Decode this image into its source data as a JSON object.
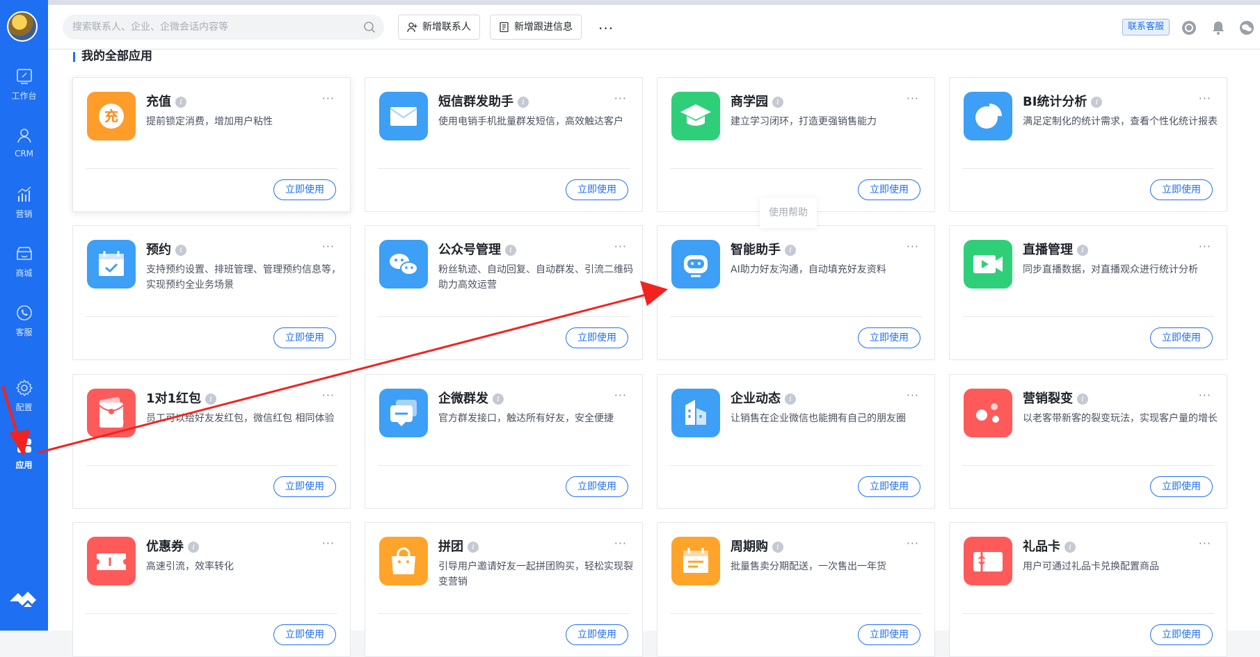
{
  "sidebar": {
    "items": [
      {
        "label": "工作台",
        "icon": "workbench-icon"
      },
      {
        "label": "CRM",
        "icon": "user-icon"
      },
      {
        "label": "营销",
        "icon": "marketing-chart-icon"
      },
      {
        "label": "商城",
        "icon": "store-icon"
      },
      {
        "label": "客服",
        "icon": "phone-chat-icon"
      },
      {
        "label": "配置",
        "icon": "gear-icon"
      },
      {
        "label": "应用",
        "icon": "apps-grid-icon"
      }
    ],
    "active": "应用"
  },
  "topbar": {
    "search_placeholder": "搜索联系人、企业、企微会话内容等",
    "add_contact": "新增联系人",
    "add_followup": "新增跟进信息",
    "support": "联系客服"
  },
  "section": {
    "title": "我的全部应用"
  },
  "tooltip": "使用帮助",
  "use_label": "立即使用",
  "cards": [
    {
      "name": "充值",
      "desc": "提前锁定消费，增加用户粘性",
      "icon": "recharge-icon",
      "color": "#ff9c2a"
    },
    {
      "name": "短信群发助手",
      "desc": "使用电销手机批量群发短信，高效触达客户",
      "icon": "sms-envelope-icon",
      "color": "#3d9ff5"
    },
    {
      "name": "商学园",
      "desc": "建立学习闭环，打造更强销售能力",
      "icon": "graduation-cap-icon",
      "color": "#2fcf7a"
    },
    {
      "name": "BI统计分析",
      "desc": "满足定制化的统计需求，查看个性化统计报表",
      "icon": "pie-chart-icon",
      "color": "#3d9ff5"
    },
    {
      "name": "预约",
      "desc": "支持预约设置、排班管理、管理预约信息等，实现预约全业务场景",
      "icon": "calendar-check-icon",
      "color": "#3d9ff5"
    },
    {
      "name": "公众号管理",
      "desc": "粉丝轨迹、自动回复、自动群发、引流二维码 助力高效运营",
      "icon": "wechat-icon",
      "color": "#3d9ff5"
    },
    {
      "name": "智能助手",
      "desc": "AI助力好友沟通，自动填充好友资料",
      "icon": "robot-icon",
      "color": "#3d9ff5"
    },
    {
      "name": "直播管理",
      "desc": "同步直播数据，对直播观众进行统计分析",
      "icon": "video-camera-icon",
      "color": "#2fcf7a"
    },
    {
      "name": "1对1红包",
      "desc": "员工可以给好友发红包，微信红包 相同体验",
      "icon": "red-packet-icon",
      "color": "#ff5a5a"
    },
    {
      "name": "企微群发",
      "desc": "官方群发接口，触达所有好友，安全便捷",
      "icon": "group-message-icon",
      "color": "#3d9ff5"
    },
    {
      "name": "企业动态",
      "desc": "让销售在企业微信也能拥有自己的朋友圈",
      "icon": "building-icon",
      "color": "#3d9ff5"
    },
    {
      "name": "营销裂变",
      "desc": "以老客带新客的裂变玩法，实现客户量的增长",
      "icon": "fission-dots-icon",
      "color": "#ff5a5a"
    },
    {
      "name": "优惠券",
      "desc": "高速引流，效率转化",
      "icon": "coupon-icon",
      "color": "#ff5a5a"
    },
    {
      "name": "拼团",
      "desc": "引导用户邀请好友一起拼团购买，轻松实现裂变营销",
      "icon": "shopping-bag-icon",
      "color": "#ffa42a"
    },
    {
      "name": "周期购",
      "desc": "批量售卖分期配送，一次售出一年货",
      "icon": "cycle-calendar-icon",
      "color": "#ffa42a"
    },
    {
      "name": "礼品卡",
      "desc": "用户可通过礼品卡兑换配置商品",
      "icon": "gift-card-icon",
      "color": "#ff5a5a"
    }
  ]
}
